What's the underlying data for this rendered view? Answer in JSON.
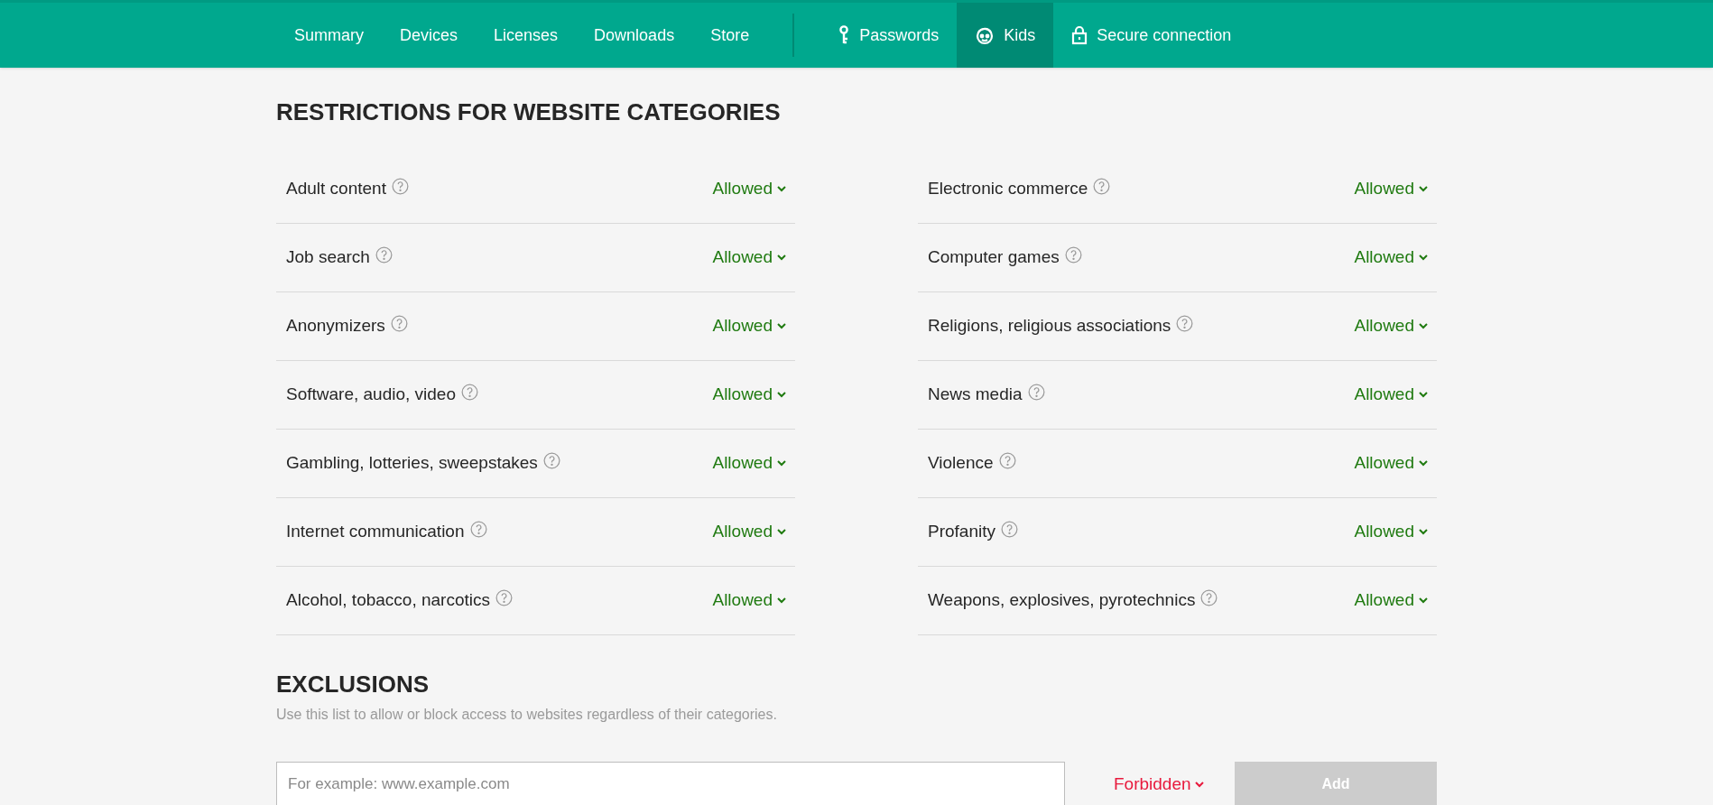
{
  "nav": {
    "primary": [
      {
        "label": "Summary",
        "selected": false
      },
      {
        "label": "Devices",
        "selected": false
      },
      {
        "label": "Licenses",
        "selected": false
      },
      {
        "label": "Downloads",
        "selected": false
      },
      {
        "label": "Store",
        "selected": false
      }
    ],
    "secondary": [
      {
        "label": "Passwords",
        "kind": "key",
        "selected": false
      },
      {
        "label": "Kids",
        "kind": "kid",
        "selected": true
      },
      {
        "label": "Secure connection",
        "kind": "lock",
        "selected": false
      }
    ]
  },
  "restrictions": {
    "title": "RESTRICTIONS FOR WEBSITE CATEGORIES",
    "columns": [
      [
        {
          "label": "Adult content",
          "status": "Allowed",
          "kind": "allowed"
        },
        {
          "label": "Job search",
          "status": "Allowed",
          "kind": "allowed"
        },
        {
          "label": "Anonymizers",
          "status": "Allowed",
          "kind": "allowed"
        },
        {
          "label": "Software, audio, video",
          "status": "Allowed",
          "kind": "allowed"
        },
        {
          "label": "Gambling, lotteries, sweepstakes",
          "status": "Allowed",
          "kind": "allowed"
        },
        {
          "label": "Internet communication",
          "status": "Allowed",
          "kind": "allowed"
        },
        {
          "label": "Alcohol, tobacco, narcotics",
          "status": "Allowed",
          "kind": "allowed"
        }
      ],
      [
        {
          "label": "Electronic commerce",
          "status": "Allowed",
          "kind": "allowed"
        },
        {
          "label": "Computer games",
          "status": "Allowed",
          "kind": "allowed"
        },
        {
          "label": "Religions, religious associations",
          "status": "Allowed",
          "kind": "allowed"
        },
        {
          "label": "News media",
          "status": "Allowed",
          "kind": "allowed"
        },
        {
          "label": "Violence",
          "status": "Allowed",
          "kind": "allowed"
        },
        {
          "label": "Profanity",
          "status": "Allowed",
          "kind": "allowed"
        },
        {
          "label": "Weapons, explosives, pyrotechnics",
          "status": "Allowed",
          "kind": "allowed"
        }
      ]
    ]
  },
  "exclusions": {
    "title": "EXCLUSIONS",
    "description": "Use this list to allow or block access to websites regardless of their categories.",
    "url_field": {
      "placeholder": "For example: www.example.com"
    },
    "mode": {
      "label": "Forbidden",
      "kind": "forbidden"
    },
    "add_button": {
      "label": "Add",
      "disabled": true
    }
  }
}
